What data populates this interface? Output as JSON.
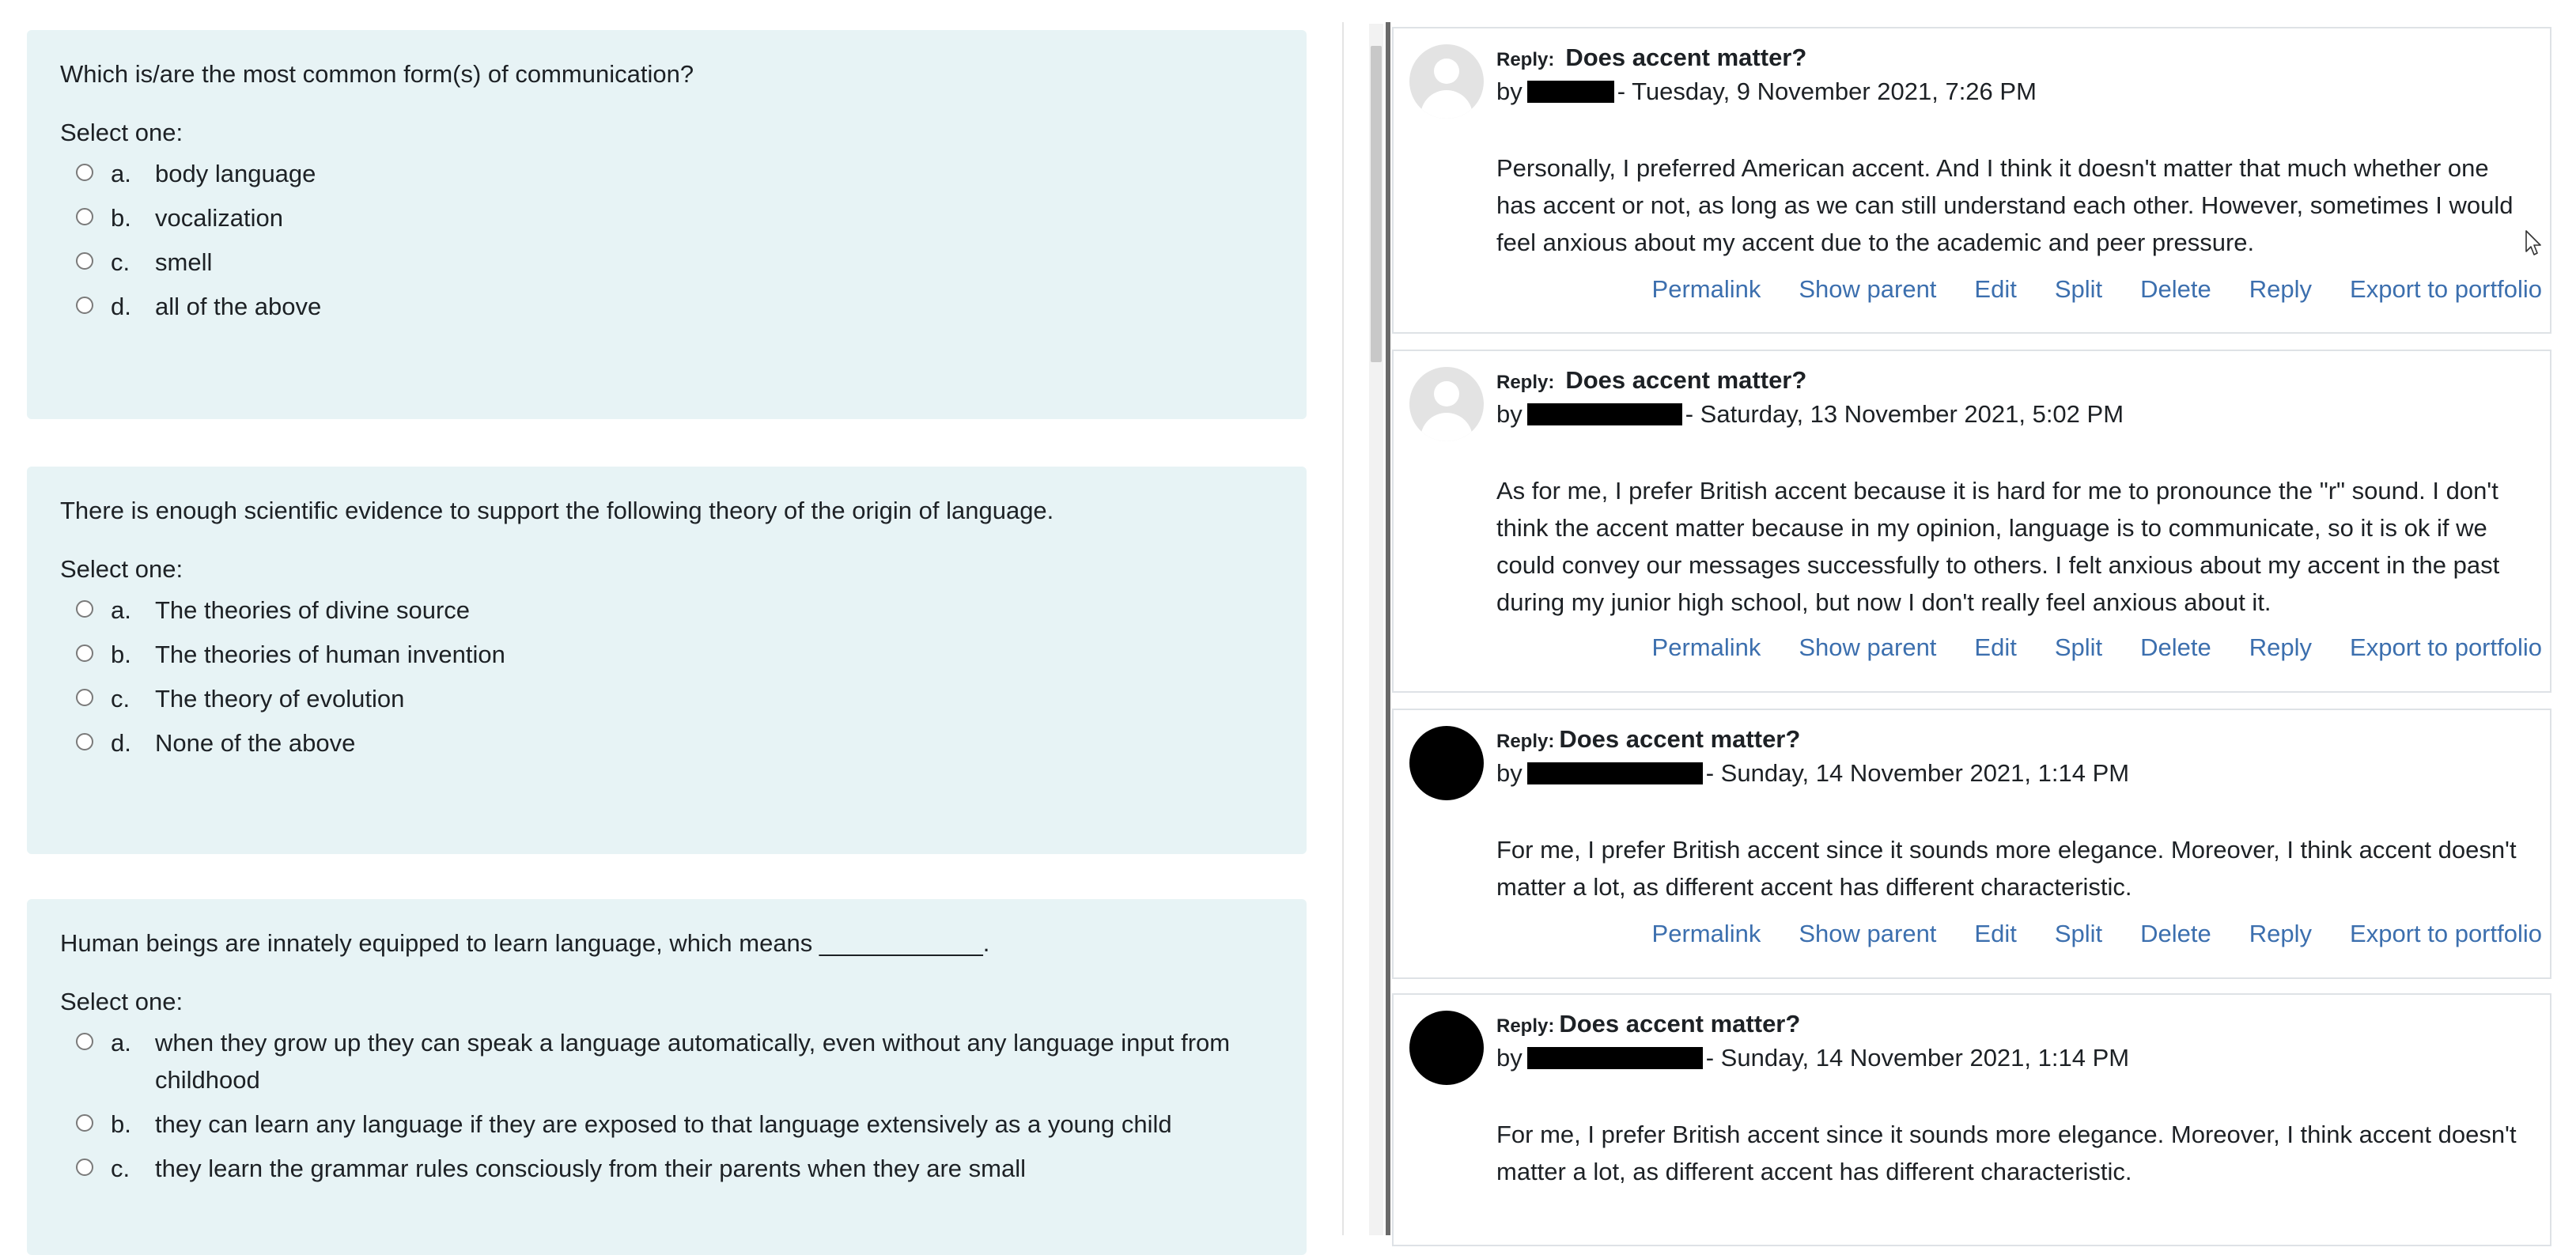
{
  "quiz": {
    "questions": [
      {
        "text": "Which is/are the most common form(s) of communication?",
        "prompt": "Select one:",
        "options": [
          {
            "letter": "a.",
            "text": "body language"
          },
          {
            "letter": "b.",
            "text": "vocalization"
          },
          {
            "letter": "c.",
            "text": "smell"
          },
          {
            "letter": "d.",
            "text": "all of the above"
          }
        ]
      },
      {
        "text": "There is enough scientific evidence to support the following theory of the origin of language.",
        "prompt": "Select one:",
        "options": [
          {
            "letter": "a.",
            "text": "The theories of divine source"
          },
          {
            "letter": "b.",
            "text": "The theories of human invention"
          },
          {
            "letter": "c.",
            "text": "The theory of evolution"
          },
          {
            "letter": "d.",
            "text": "None of the above"
          }
        ]
      },
      {
        "text": "Human beings are innately equipped to learn language, which means ____________.",
        "prompt": "Select one:",
        "options": [
          {
            "letter": "a.",
            "text": "when they grow up they can speak a language automatically, even without any language input from childhood"
          },
          {
            "letter": "b.",
            "text": "they can learn any language if they are exposed to that language extensively as a young child"
          },
          {
            "letter": "c.",
            "text": "they learn the grammar rules consciously from their parents when they are small"
          }
        ]
      }
    ]
  },
  "forum": {
    "commands": [
      "Permalink",
      "Show parent",
      "Edit",
      "Split",
      "Delete",
      "Reply",
      "Export to portfolio"
    ],
    "posts": [
      {
        "reply_label": "Reply:",
        "subject": "Does accent matter?",
        "by": "by",
        "date": "- Tuesday, 9 November 2021, 7:26 PM",
        "avatar": "default-user-icon",
        "body": "Personally, I preferred American accent. And I think it doesn't matter that much whether one has accent or not, as long as we can still understand each other. However, sometimes I would feel anxious about my accent due to the academic and peer pressure."
      },
      {
        "reply_label": "Reply:",
        "subject": "Does accent matter?",
        "by": "by",
        "date": "- Saturday, 13 November 2021, 5:02 PM",
        "avatar": "default-user-icon",
        "body": "As for me, I prefer British accent because it is hard for me to pronounce the \"r\" sound. I don't think the accent matter because in my opinion, language is to communicate, so it is ok if we could convey our messages successfully to others. I felt anxious about my accent in the past during my junior high school, but now I don't really feel anxious about it."
      },
      {
        "reply_label": "Reply:",
        "subject": "Does accent matter?",
        "by": "by",
        "date": "- Sunday, 14 November 2021, 1:14 PM",
        "avatar": "black-avatar",
        "body": "For me, I prefer British accent since it sounds more elegance. Moreover, I think accent doesn't matter a lot, as different accent has different characteristic."
      },
      {
        "reply_label": "Reply:",
        "subject": "Does accent matter?",
        "by": "by",
        "date": "- Sunday, 14 November 2021, 1:14 PM",
        "avatar": "black-avatar",
        "body": "For me, I prefer British accent since it sounds more elegance. Moreover, I think accent doesn't matter a lot, as different accent has different characteristic."
      }
    ]
  },
  "colors": {
    "question_bg": "#e7f3f5",
    "link": "#3c6fae",
    "text": "#1d2125"
  }
}
